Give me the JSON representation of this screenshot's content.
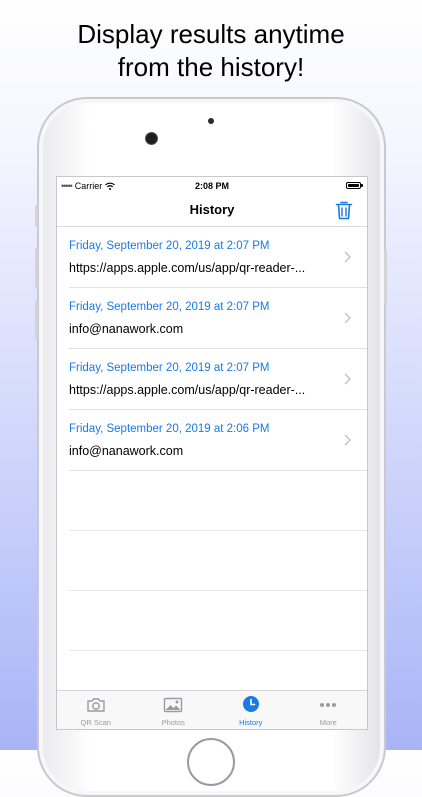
{
  "headline": {
    "line1": "Display results anytime",
    "line2": "from the history!"
  },
  "status_bar": {
    "carrier": "Carrier",
    "time": "2:08 PM"
  },
  "nav": {
    "title": "History",
    "trash_icon": "trash-icon"
  },
  "history": [
    {
      "date": "Friday, September 20, 2019 at 2:07 PM",
      "value": "https://apps.apple.com/us/app/qr-reader-..."
    },
    {
      "date": "Friday, September 20, 2019 at 2:07 PM",
      "value": "info@nanawork.com"
    },
    {
      "date": "Friday, September 20, 2019 at 2:07 PM",
      "value": "https://apps.apple.com/us/app/qr-reader-..."
    },
    {
      "date": "Friday, September 20, 2019 at 2:06 PM",
      "value": "info@nanawork.com"
    }
  ],
  "tabs": [
    {
      "label": "QR Scan",
      "icon": "camera-icon"
    },
    {
      "label": "Photos",
      "icon": "photos-icon"
    },
    {
      "label": "History",
      "icon": "clock-icon",
      "active": true
    },
    {
      "label": "More",
      "icon": "more-icon"
    }
  ],
  "colors": {
    "accent": "#1a7ae6",
    "tab_inactive": "#9b9ba0"
  }
}
